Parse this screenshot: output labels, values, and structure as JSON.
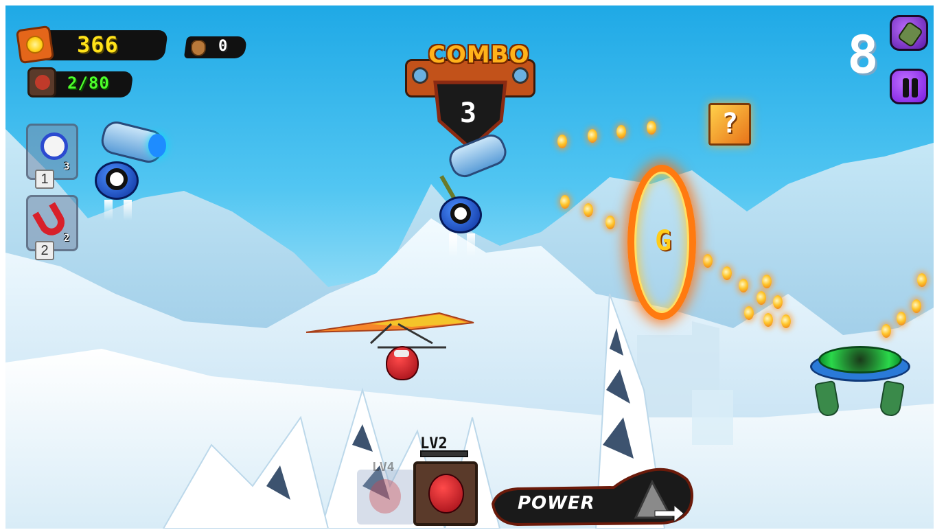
{
  "hud": {
    "coins": "366",
    "bags": "0",
    "kills": "2/80",
    "distance": "8"
  },
  "combo": {
    "title": "COMBO",
    "count": "3"
  },
  "powerups": [
    {
      "name": "stopwatch",
      "count": "3",
      "key": "1"
    },
    {
      "name": "magnet",
      "count": "2",
      "key": "2"
    }
  ],
  "characters": {
    "locked_level": "LV4",
    "active_level": "LV2",
    "active_level_progress": 0.0
  },
  "power_button": {
    "label": "POWER"
  },
  "ring_letter": "G",
  "mystery_box": "?",
  "colors": {
    "coin_yellow": "#ffd800",
    "kill_green": "#4cff2a",
    "pause_purple": "#9b2cf0",
    "ring_orange": "#ff6a00"
  },
  "icons": {
    "coin": "gold-coin-icon",
    "bag": "money-bag-icon",
    "kills": "robot-kill-icon",
    "cannon": "cannon-icon",
    "pause": "pause-icon"
  }
}
